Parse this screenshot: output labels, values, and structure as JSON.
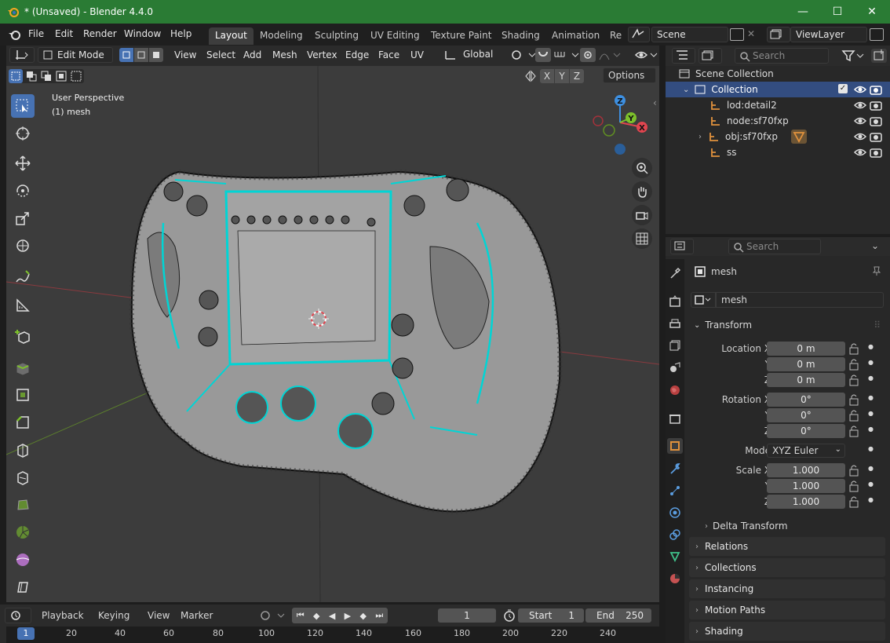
{
  "window": {
    "title": "* (Unsaved) - Blender 4.4.0",
    "minimize": "—",
    "maximize": "☐",
    "close": "✕"
  },
  "menu": [
    "File",
    "Edit",
    "Render",
    "Window",
    "Help"
  ],
  "workspaces": [
    "Layout",
    "Modeling",
    "Sculpting",
    "UV Editing",
    "Texture Paint",
    "Shading",
    "Animation",
    "Re"
  ],
  "active_workspace": "Layout",
  "scene": {
    "name": "Scene",
    "view_layer": "ViewLayer"
  },
  "viewport": {
    "mode": "Edit Mode",
    "menus": [
      "View",
      "Select",
      "Add",
      "Mesh",
      "Vertex",
      "Edge",
      "Face",
      "UV"
    ],
    "orientation": "Global",
    "options_label": "Options",
    "axis_labels": [
      "X",
      "Y",
      "Z"
    ],
    "perspective_label": "User Perspective",
    "object_label": "(1) mesh",
    "gizmo": {
      "x": "X",
      "y": "Y",
      "z": "Z"
    }
  },
  "outliner": {
    "search_placeholder": "Search",
    "scene_collection": "Scene Collection",
    "collection": "Collection",
    "items": [
      "lod:detail2",
      "node:sf70fxp",
      "obj:sf70fxp",
      "ss"
    ]
  },
  "properties": {
    "search_placeholder": "Search",
    "object_name": "mesh",
    "object_field": "mesh",
    "transform_label": "Transform",
    "location": {
      "label": "Location X",
      "x": "0 m",
      "y": "0 m",
      "z": "0 m"
    },
    "rotation": {
      "label": "Rotation X",
      "x": "0°",
      "y": "0°",
      "z": "0°"
    },
    "mode_label": "Mode",
    "mode_value": "XYZ Euler",
    "scale": {
      "label": "Scale X",
      "x": "1.000",
      "y": "1.000",
      "z": "1.000"
    },
    "axis_y": "Y",
    "axis_z": "Z",
    "delta_transform": "Delta Transform",
    "panels": [
      "Relations",
      "Collections",
      "Instancing",
      "Motion Paths",
      "Shading"
    ]
  },
  "timeline": {
    "menus": [
      "Playback",
      "Keying",
      "View",
      "Marker"
    ],
    "current_frame": "1",
    "start_label": "Start",
    "start": "1",
    "end_label": "End",
    "end": "250",
    "ruler": [
      "1",
      "20",
      "40",
      "60",
      "80",
      "100",
      "120",
      "140",
      "160",
      "180",
      "200",
      "220",
      "240"
    ]
  },
  "colors": {
    "title_bar": "#2a7b34",
    "accent": "#4772b3",
    "edge_select": "#00d5d5",
    "axis_x": "#e0454f",
    "axis_y": "#7cc02b",
    "axis_z": "#3d8fe0"
  }
}
